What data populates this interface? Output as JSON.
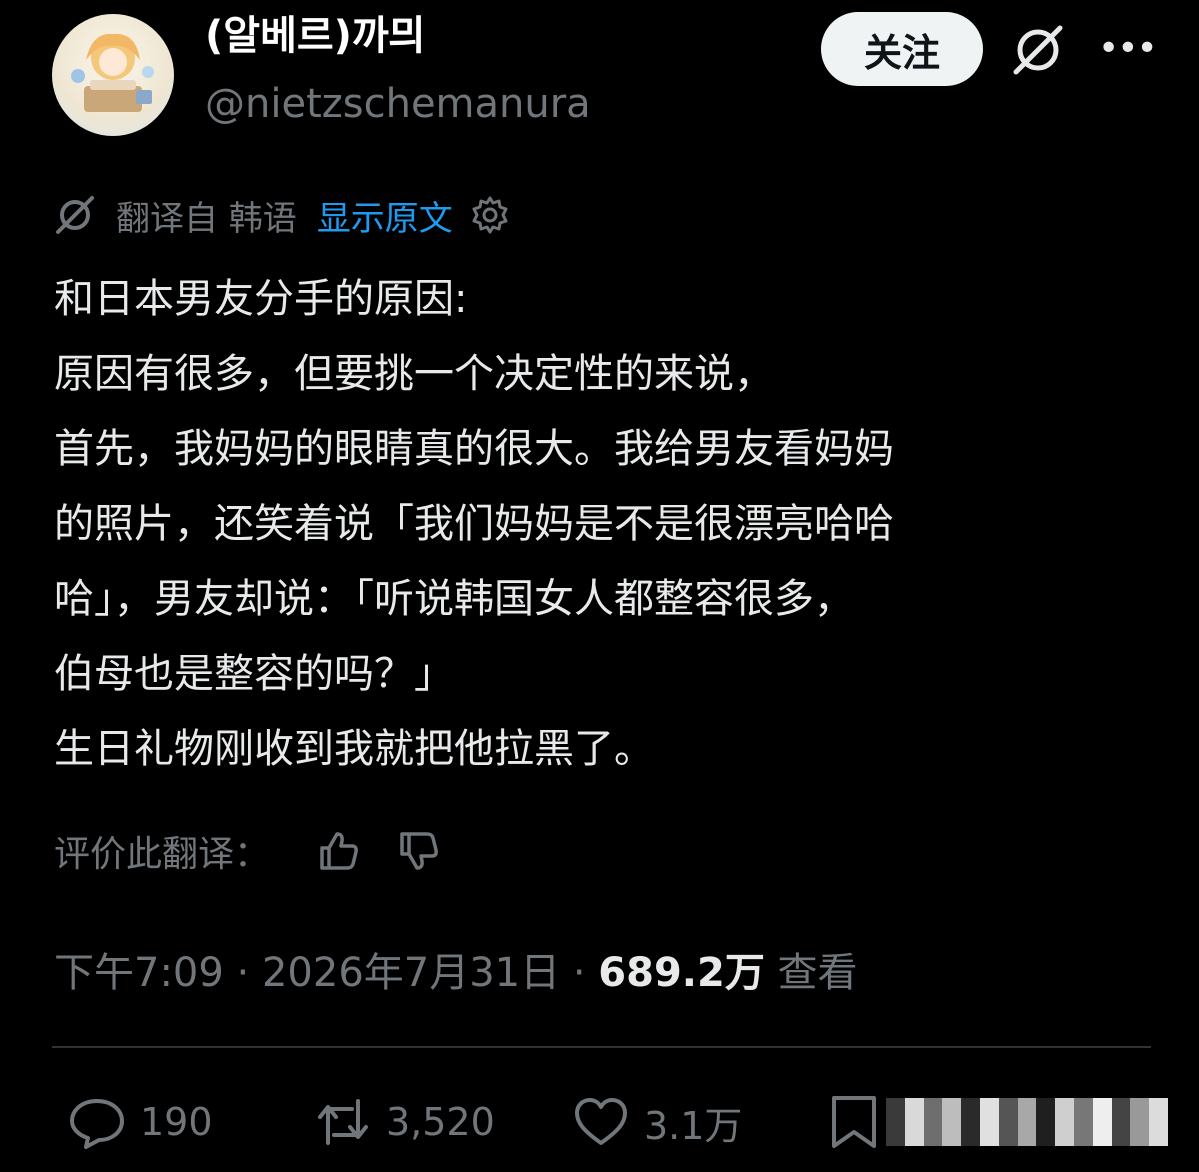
{
  "user": {
    "display_name": "(알베르)까믜",
    "handle": "@nietzschemanura",
    "follow_label": "关注"
  },
  "icons": {
    "grok": "grok-icon",
    "more": "more-icon",
    "more_glyph": "•••",
    "gear": "gear-icon",
    "thumb_up": "thumbs-up-icon",
    "thumb_down": "thumbs-down-icon",
    "reply": "reply-icon",
    "repost": "repost-icon",
    "like": "like-icon",
    "bookmark": "bookmark-icon"
  },
  "translation": {
    "label": "翻译自 韩语",
    "show_original": "显示原文"
  },
  "post": {
    "lines": [
      "和日本男友分手的原因:",
      "原因有很多，但要挑一个决定性的来说，",
      "首先，我妈妈的眼睛真的很大。我给男友看妈妈",
      "的照片，还笑着说「我们妈妈是不是很漂亮哈哈",
      "哈」，男友却说：「听说韩国女人都整容很多，",
      "伯母也是整容的吗？」",
      "生日礼物刚收到我就把他拉黑了。"
    ]
  },
  "rate": {
    "label": "评价此翻译："
  },
  "meta": {
    "time": "下午7:09",
    "date": "2026年7月31日",
    "separator": " · ",
    "views_count": "689.2万",
    "views_label": "查看"
  },
  "actions": {
    "replies": "190",
    "reposts": "3,520",
    "likes": "3.1万"
  },
  "colors": {
    "background": "#000000",
    "text": "#e7e9ea",
    "muted": "#71767b",
    "link": "#1d9bf0",
    "divider": "#2f3336",
    "follow_bg": "#eff3f4"
  }
}
